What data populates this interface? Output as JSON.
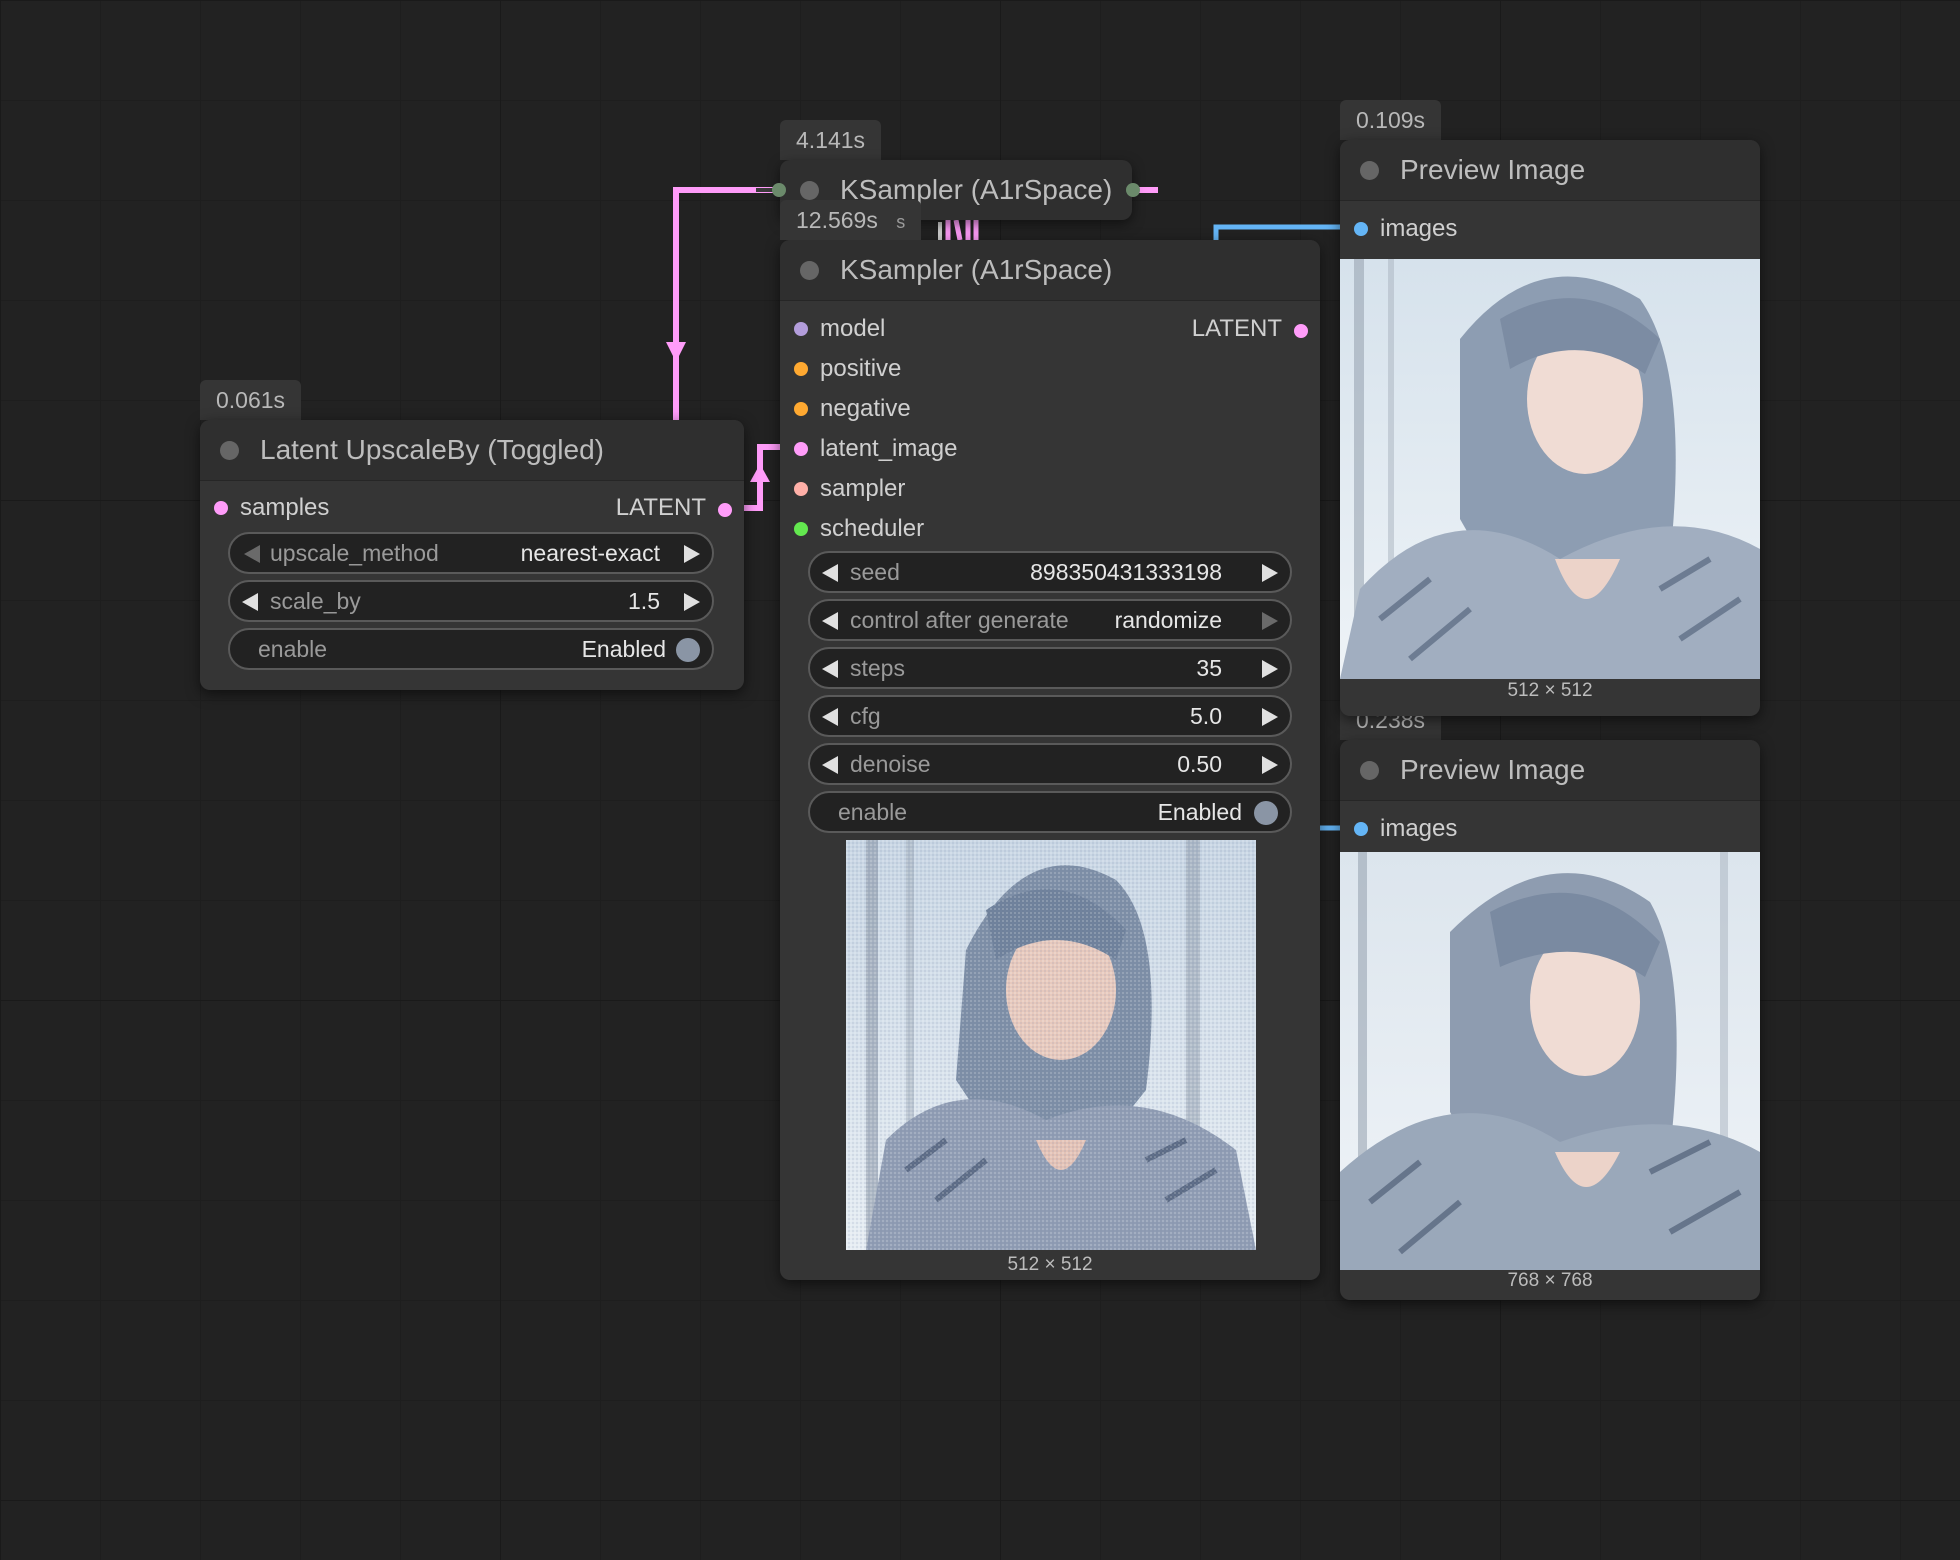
{
  "colors": {
    "latent": "#ff9cf9",
    "model": "#b39ddb",
    "conditioning": "#ffa931",
    "sampler": "#ffb0a8",
    "scheduler": "#63e84f",
    "image": "#64b5f6",
    "canvas": "#222222",
    "node_body": "#353535"
  },
  "timings": {
    "ksampler_top": "4.141s",
    "ksampler_main": "12.569s",
    "ksampler_main_suffix": "s",
    "latent_upscale": "0.061s",
    "preview_top": "0.109s",
    "preview_bottom": "0.238s"
  },
  "ksampler_collapsed": {
    "title": "KSampler (A1rSpace)"
  },
  "latent_upscale": {
    "title": "Latent UpscaleBy (Toggled)",
    "input": "samples",
    "output": "LATENT",
    "widgets": {
      "upscale_method": {
        "label": "upscale_method",
        "value": "nearest-exact"
      },
      "scale_by": {
        "label": "scale_by",
        "value": "1.5"
      },
      "enable": {
        "label": "enable",
        "value": "Enabled"
      }
    }
  },
  "ksampler": {
    "title": "KSampler (A1rSpace)",
    "inputs": [
      "model",
      "positive",
      "negative",
      "latent_image",
      "sampler",
      "scheduler"
    ],
    "output": "LATENT",
    "widgets": {
      "seed": {
        "label": "seed",
        "value": "898350431333198"
      },
      "control_after_generate": {
        "label": "control after generate",
        "value": "randomize"
      },
      "steps": {
        "label": "steps",
        "value": "35"
      },
      "cfg": {
        "label": "cfg",
        "value": "5.0"
      },
      "denoise": {
        "label": "denoise",
        "value": "0.50"
      },
      "enable": {
        "label": "enable",
        "value": "Enabled"
      }
    },
    "preview_caption": "512 × 512"
  },
  "preview_top": {
    "title": "Preview Image",
    "input": "images",
    "caption": "512 × 512"
  },
  "preview_bottom": {
    "title": "Preview Image",
    "input": "images",
    "caption": "768 × 768"
  }
}
